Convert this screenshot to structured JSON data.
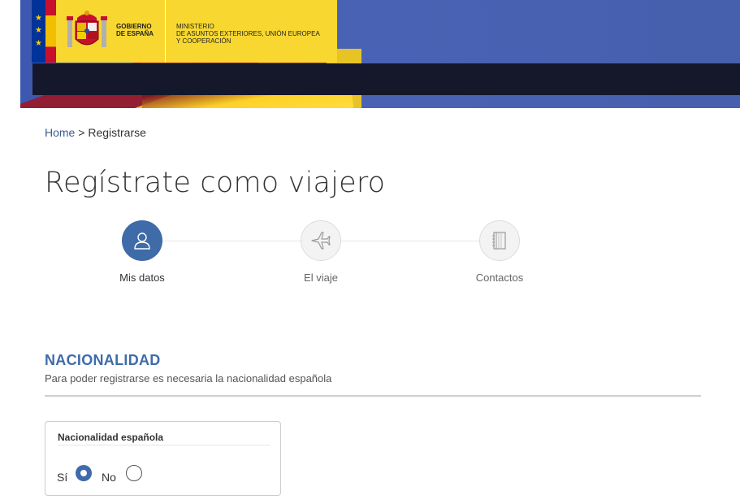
{
  "header": {
    "gov_line1": "GOBIERNO",
    "gov_line2": "DE ESPAÑA",
    "ministry_line1": "MINISTERIO",
    "ministry_line2": "DE ASUNTOS EXTERIORES, UNIÓN EUROPEA",
    "ministry_line3": "Y COOPERACIÓN"
  },
  "breadcrumb": {
    "home": "Home",
    "separator": " > ",
    "current": "Registrarse"
  },
  "page_title": "Regístrate como viajero",
  "stepper": {
    "steps": [
      {
        "label": "Mis datos",
        "icon": "user-icon",
        "active": true
      },
      {
        "label": "El viaje",
        "icon": "airplane-icon",
        "active": false
      },
      {
        "label": "Contactos",
        "icon": "address-book-icon",
        "active": false
      }
    ]
  },
  "section": {
    "title": "NACIONALIDAD",
    "subtitle": "Para poder registrarse es necesaria la nacionalidad española"
  },
  "nationality_field": {
    "legend": "Nacionalidad española",
    "options": [
      {
        "label": "Sí",
        "checked": true
      },
      {
        "label": "No",
        "checked": false
      }
    ]
  },
  "colors": {
    "accent": "#3f6ba8",
    "banner_blue": "#4660ad",
    "header_yellow": "#f8d830",
    "navbar_dark": "#15172a"
  }
}
